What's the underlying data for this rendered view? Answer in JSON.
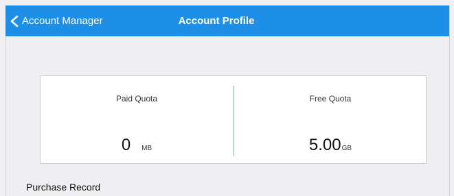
{
  "nav": {
    "back_label": "Account Manager",
    "title": "Account Profile",
    "back_icon": "chevron-left-icon"
  },
  "quota": {
    "paid": {
      "label": "Paid Quota",
      "value": "0",
      "unit": "MB"
    },
    "free": {
      "label": "Free Quota",
      "value": "5.00",
      "unit": "GB"
    }
  },
  "sections": {
    "purchase_record": "Purchase Record"
  },
  "colors": {
    "nav_bg": "#1d8fe6",
    "page_bg": "#efeff1",
    "card_bg": "#ffffff",
    "divider": "#8aa2c0"
  }
}
